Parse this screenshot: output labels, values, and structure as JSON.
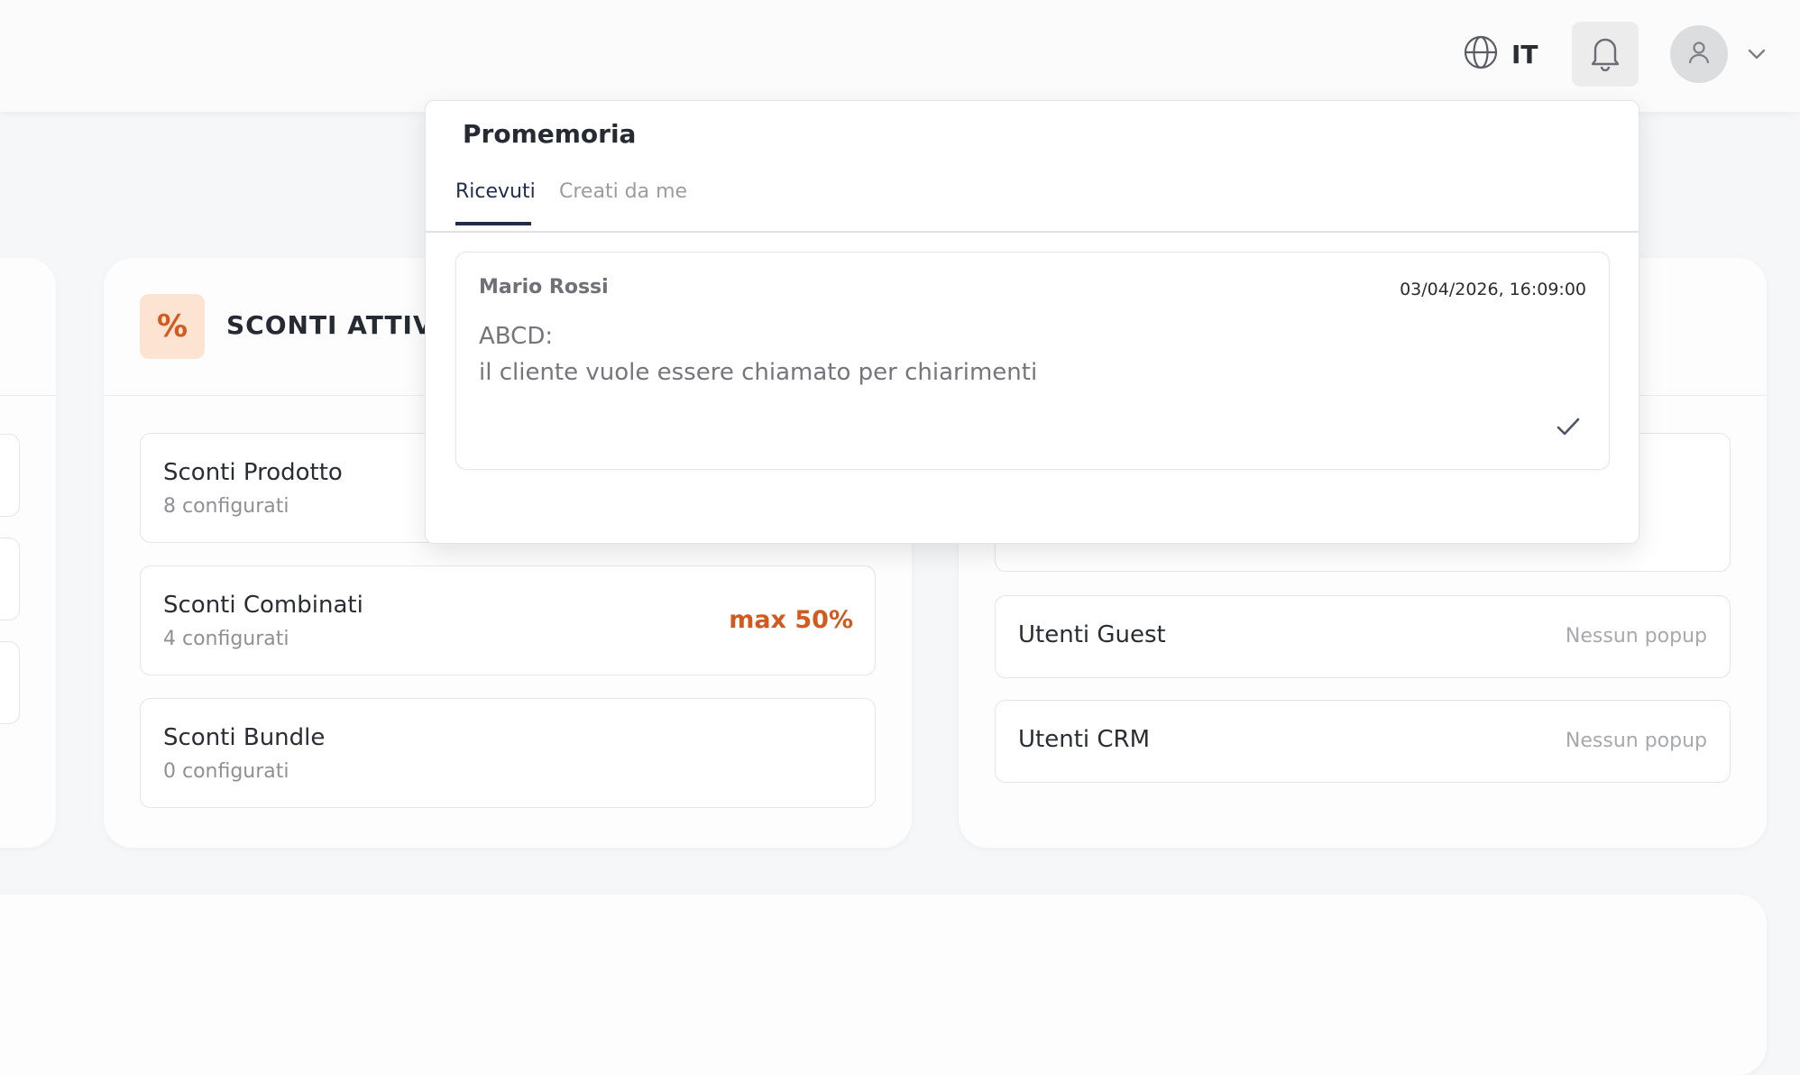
{
  "header": {
    "language_code": "IT",
    "icons": {
      "language": "globe-icon",
      "notifications": "bell-icon",
      "avatar": "user-icon",
      "menu": "chevron-down-icon"
    }
  },
  "discounts_card": {
    "title": "SCONTI ATTIVI",
    "icon_glyph": "%",
    "accent_color": "#d25a1e",
    "rows": [
      {
        "title": "Sconti Prodotto",
        "subtitle": "8 configurati",
        "badge": ""
      },
      {
        "title": "Sconti Combinati",
        "subtitle": "4 configurati",
        "badge": "max 50%"
      },
      {
        "title": "Sconti Bundle",
        "subtitle": "0 configurati",
        "badge": ""
      }
    ]
  },
  "popups_card": {
    "rows": [
      {
        "title": "",
        "status": ""
      },
      {
        "title": "Utenti Guest",
        "status": "Nessun popup"
      },
      {
        "title": "Utenti CRM",
        "status": "Nessun popup"
      }
    ]
  },
  "reminders_panel": {
    "title": "Promemoria",
    "tabs": [
      {
        "label": "Ricevuti",
        "active": true
      },
      {
        "label": "Creati da me",
        "active": false
      }
    ],
    "items": [
      {
        "author": "Mario Rossi",
        "timestamp": "03/04/2026, 16:09:00",
        "subject": "ABCD:",
        "message": "il cliente vuole essere chiamato per chiarimenti"
      }
    ],
    "active_tab_color": "#1f2e4f"
  }
}
